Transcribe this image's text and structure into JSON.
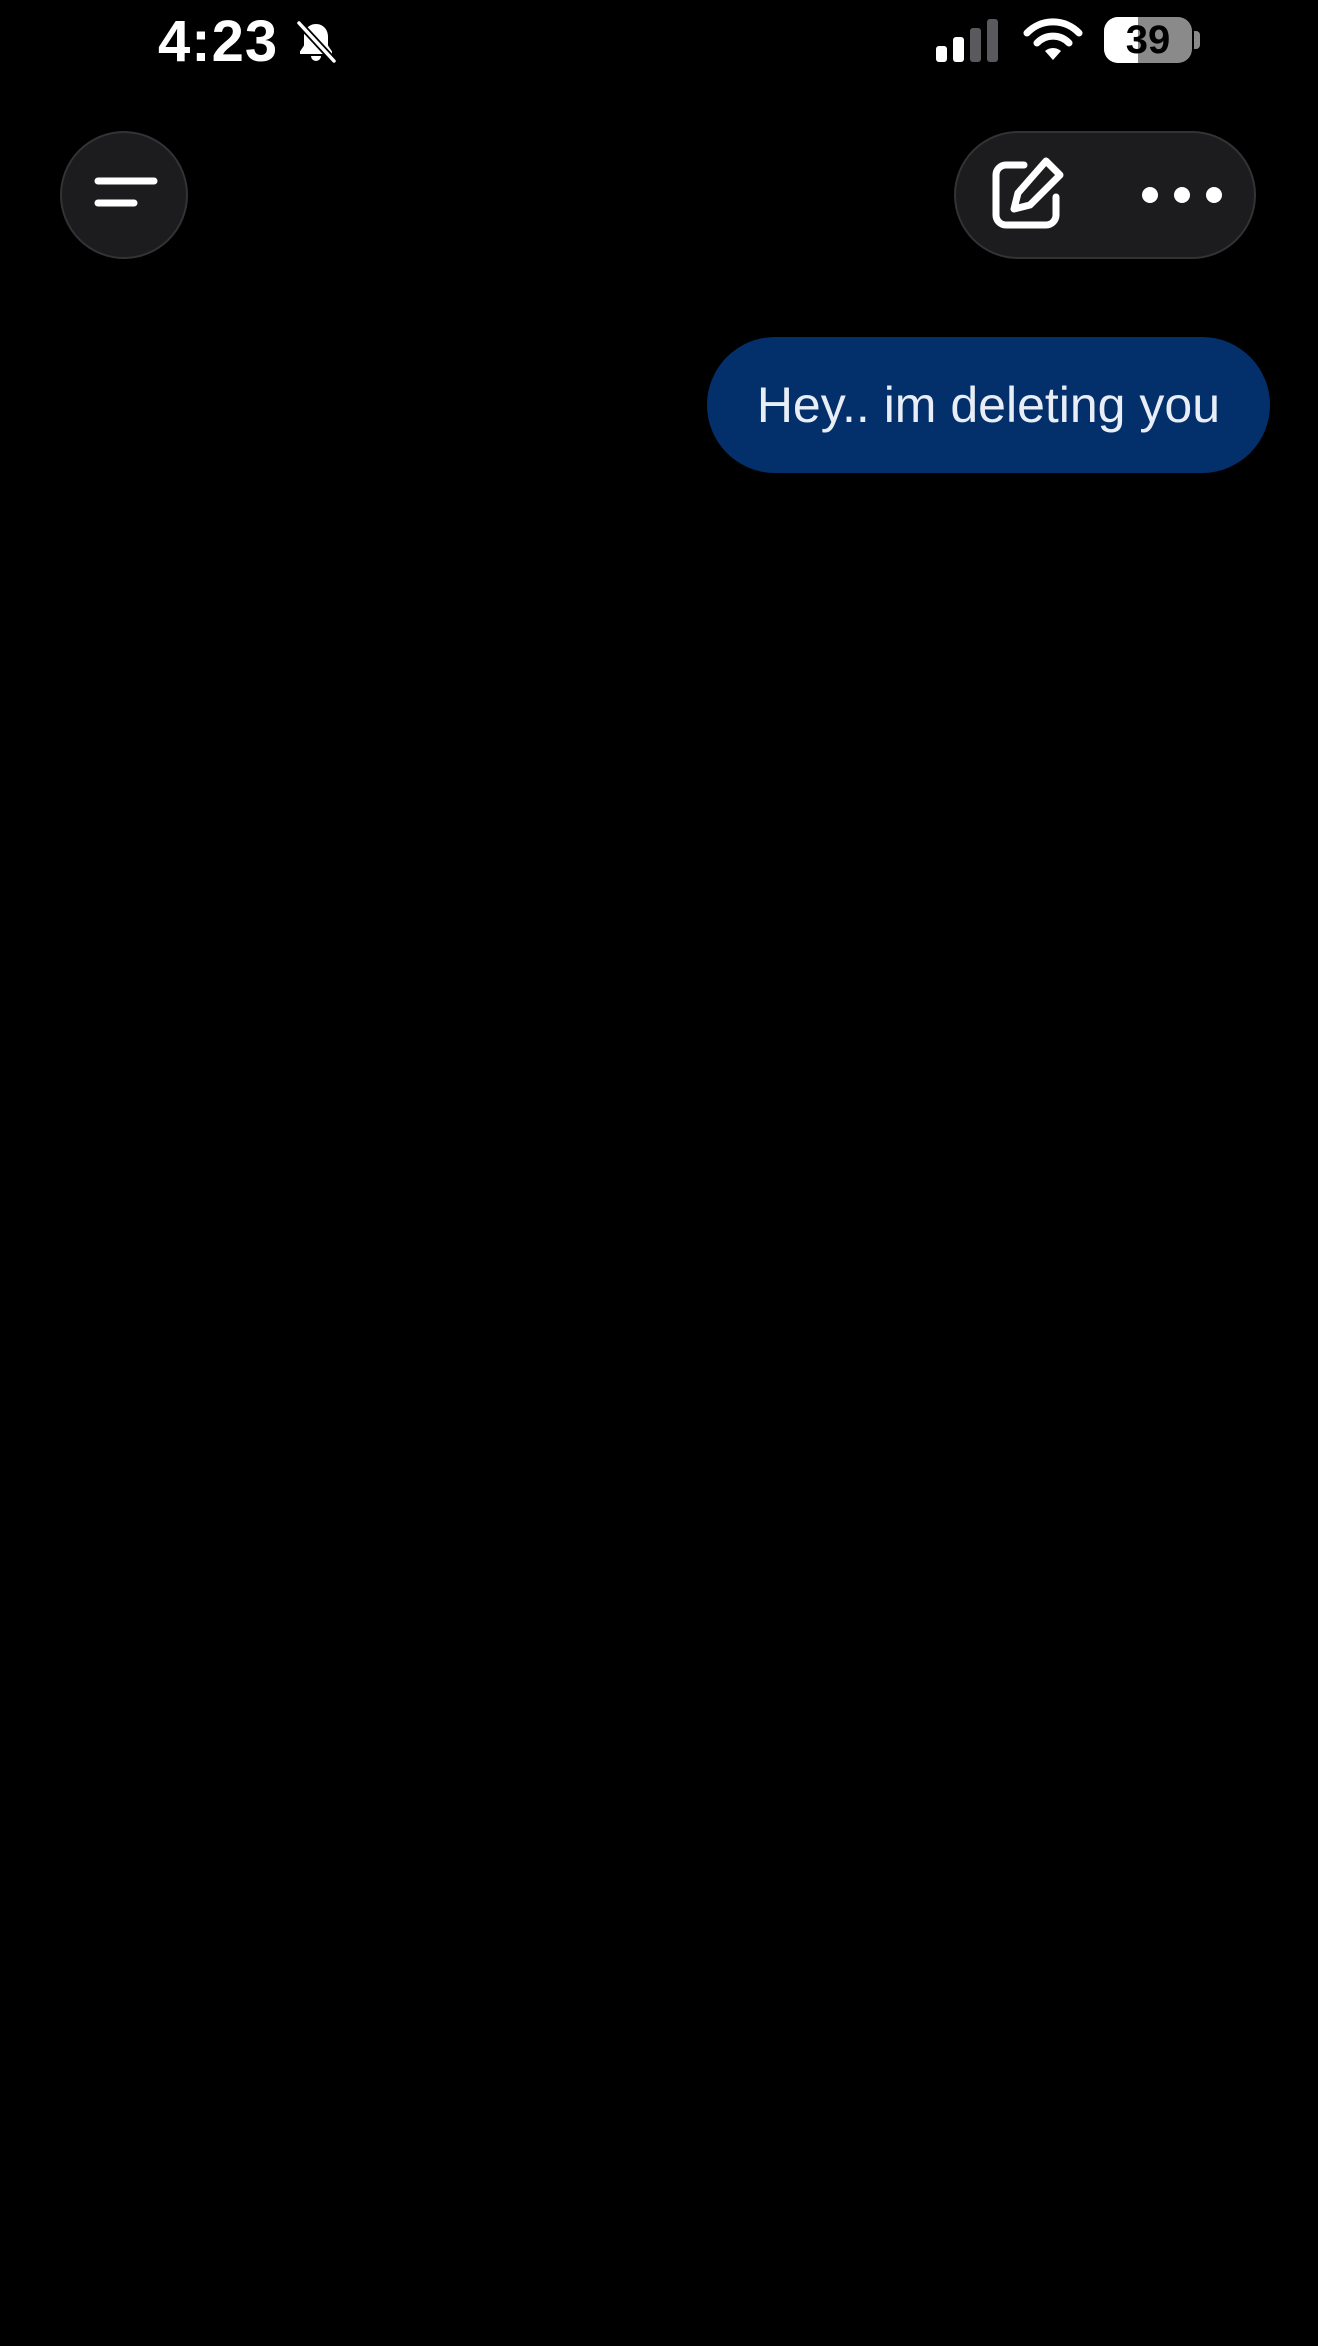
{
  "status_bar": {
    "time": "4:23",
    "battery_level": "39",
    "silent_icon": "bell-slash-icon",
    "signal_icon": "cellular-signal-icon",
    "wifi_icon": "wifi-icon"
  },
  "header": {
    "menu_icon": "menu-lines-icon",
    "compose_icon": "compose-icon",
    "more_icon": "ellipsis-icon"
  },
  "chat": {
    "messages": [
      {
        "role": "user",
        "text": "Hey.. im deleting you"
      }
    ]
  },
  "colors": {
    "background": "#000000",
    "user_bubble": "#03306a",
    "control_surface": "#1c1c1e"
  }
}
